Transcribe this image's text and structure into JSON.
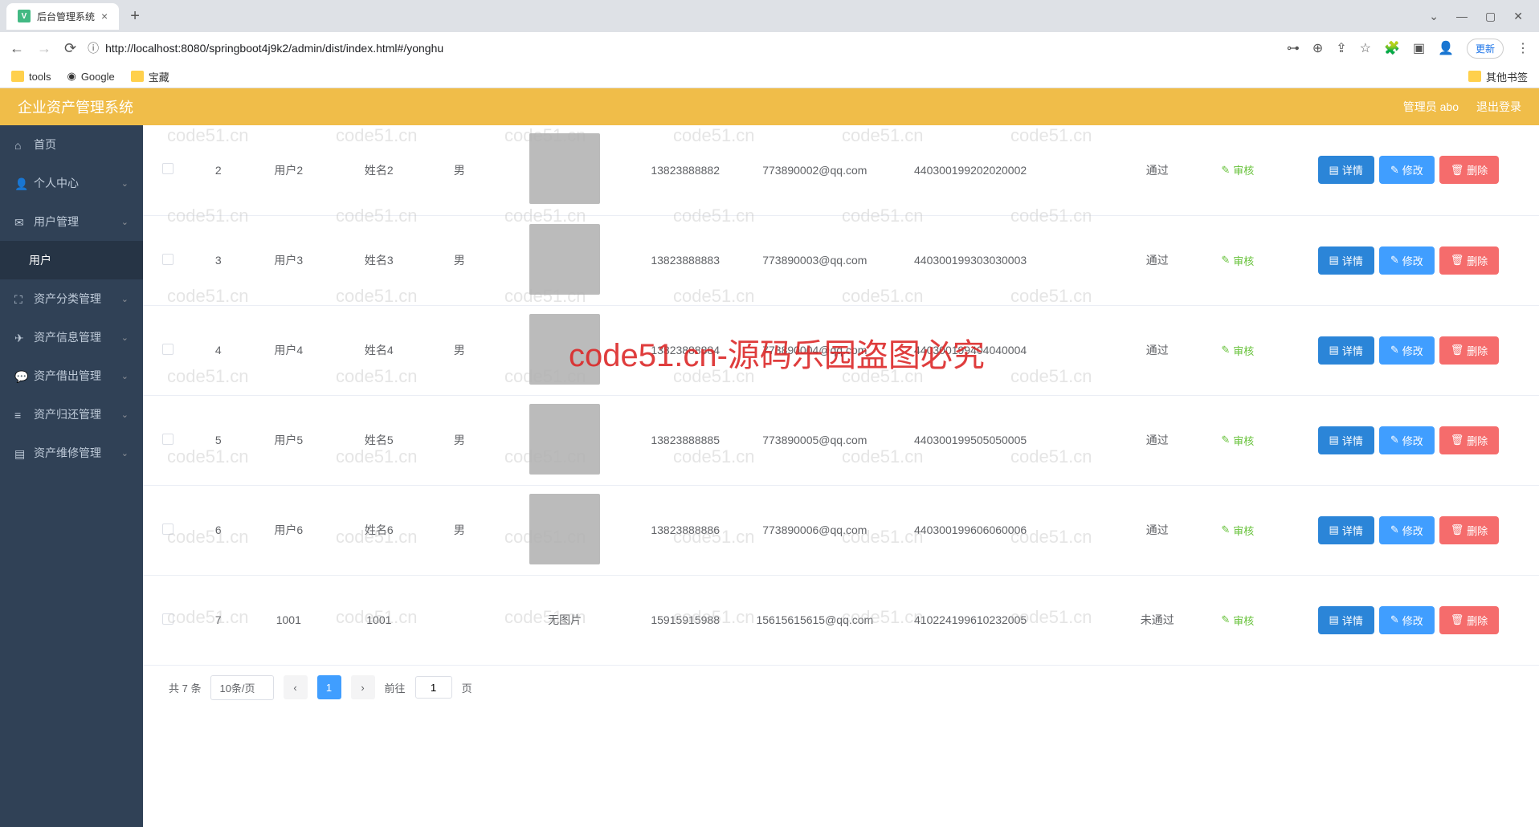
{
  "browser": {
    "tab_title": "后台管理系统",
    "url": "http://localhost:8080/springboot4j9k2/admin/dist/index.html#/yonghu",
    "update_label": "更新",
    "bookmarks": {
      "tools": "tools",
      "google": "Google",
      "treasure": "宝藏",
      "other": "其他书签"
    }
  },
  "header": {
    "title": "企业资产管理系统",
    "admin": "管理员 abo",
    "logout": "退出登录"
  },
  "sidebar": {
    "home": "首页",
    "personal": "个人中心",
    "user_mgmt": "用户管理",
    "user": "用户",
    "asset_category": "资产分类管理",
    "asset_info": "资产信息管理",
    "asset_borrow": "资产借出管理",
    "asset_return": "资产归还管理",
    "asset_repair": "资产维修管理"
  },
  "table": {
    "rows": [
      {
        "idx": "2",
        "user": "用户2",
        "name": "姓名2",
        "gender": "男",
        "has_img": true,
        "phone": "13823888882",
        "email": "773890002@qq.com",
        "idcard": "440300199202020002",
        "status": "通过"
      },
      {
        "idx": "3",
        "user": "用户3",
        "name": "姓名3",
        "gender": "男",
        "has_img": true,
        "phone": "13823888883",
        "email": "773890003@qq.com",
        "idcard": "440300199303030003",
        "status": "通过"
      },
      {
        "idx": "4",
        "user": "用户4",
        "name": "姓名4",
        "gender": "男",
        "has_img": true,
        "phone": "13823888884",
        "email": "773890004@qq.com",
        "idcard": "440300199404040004",
        "status": "通过"
      },
      {
        "idx": "5",
        "user": "用户5",
        "name": "姓名5",
        "gender": "男",
        "has_img": true,
        "phone": "13823888885",
        "email": "773890005@qq.com",
        "idcard": "440300199505050005",
        "status": "通过"
      },
      {
        "idx": "6",
        "user": "用户6",
        "name": "姓名6",
        "gender": "男",
        "has_img": true,
        "phone": "13823888886",
        "email": "773890006@qq.com",
        "idcard": "440300199606060006",
        "status": "通过"
      },
      {
        "idx": "7",
        "user": "1001",
        "name": "1001",
        "gender": "",
        "has_img": false,
        "phone": "15915915988",
        "email": "15615615615@qq.com",
        "idcard": "410224199610232005",
        "status": "未通过"
      }
    ],
    "no_image": "无图片",
    "audit": "审核",
    "detail": "详情",
    "edit": "修改",
    "delete": "删除"
  },
  "pagination": {
    "total": "共 7 条",
    "page_size": "10条/页",
    "goto_prefix": "前往",
    "current": "1",
    "goto_suffix": "页"
  },
  "watermark": {
    "small": "code51.cn",
    "big": "code51.cn-源码乐园盗图必究"
  }
}
